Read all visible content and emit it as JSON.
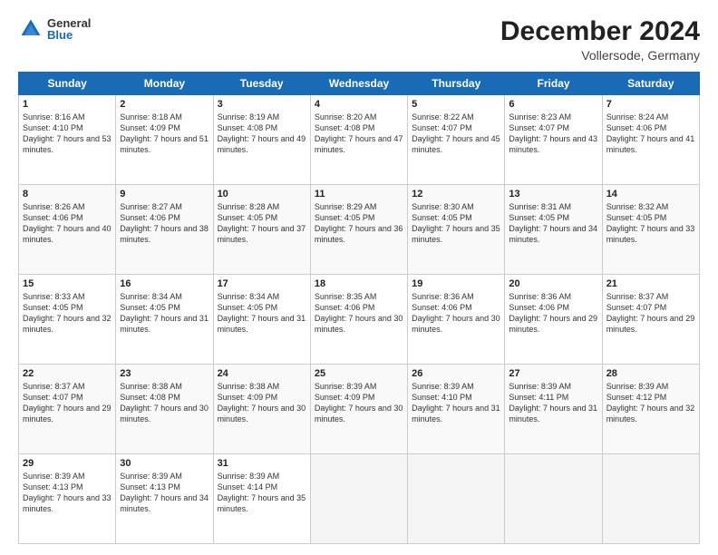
{
  "logo": {
    "general": "General",
    "blue": "Blue"
  },
  "title": {
    "month": "December 2024",
    "location": "Vollersode, Germany"
  },
  "days_of_week": [
    "Sunday",
    "Monday",
    "Tuesday",
    "Wednesday",
    "Thursday",
    "Friday",
    "Saturday"
  ],
  "weeks": [
    [
      {
        "day": "1",
        "sunrise": "8:16 AM",
        "sunset": "4:10 PM",
        "daylight": "7 hours and 53 minutes."
      },
      {
        "day": "2",
        "sunrise": "8:18 AM",
        "sunset": "4:09 PM",
        "daylight": "7 hours and 51 minutes."
      },
      {
        "day": "3",
        "sunrise": "8:19 AM",
        "sunset": "4:08 PM",
        "daylight": "7 hours and 49 minutes."
      },
      {
        "day": "4",
        "sunrise": "8:20 AM",
        "sunset": "4:08 PM",
        "daylight": "7 hours and 47 minutes."
      },
      {
        "day": "5",
        "sunrise": "8:22 AM",
        "sunset": "4:07 PM",
        "daylight": "7 hours and 45 minutes."
      },
      {
        "day": "6",
        "sunrise": "8:23 AM",
        "sunset": "4:07 PM",
        "daylight": "7 hours and 43 minutes."
      },
      {
        "day": "7",
        "sunrise": "8:24 AM",
        "sunset": "4:06 PM",
        "daylight": "7 hours and 41 minutes."
      }
    ],
    [
      {
        "day": "8",
        "sunrise": "8:26 AM",
        "sunset": "4:06 PM",
        "daylight": "7 hours and 40 minutes."
      },
      {
        "day": "9",
        "sunrise": "8:27 AM",
        "sunset": "4:06 PM",
        "daylight": "7 hours and 38 minutes."
      },
      {
        "day": "10",
        "sunrise": "8:28 AM",
        "sunset": "4:05 PM",
        "daylight": "7 hours and 37 minutes."
      },
      {
        "day": "11",
        "sunrise": "8:29 AM",
        "sunset": "4:05 PM",
        "daylight": "7 hours and 36 minutes."
      },
      {
        "day": "12",
        "sunrise": "8:30 AM",
        "sunset": "4:05 PM",
        "daylight": "7 hours and 35 minutes."
      },
      {
        "day": "13",
        "sunrise": "8:31 AM",
        "sunset": "4:05 PM",
        "daylight": "7 hours and 34 minutes."
      },
      {
        "day": "14",
        "sunrise": "8:32 AM",
        "sunset": "4:05 PM",
        "daylight": "7 hours and 33 minutes."
      }
    ],
    [
      {
        "day": "15",
        "sunrise": "8:33 AM",
        "sunset": "4:05 PM",
        "daylight": "7 hours and 32 minutes."
      },
      {
        "day": "16",
        "sunrise": "8:34 AM",
        "sunset": "4:05 PM",
        "daylight": "7 hours and 31 minutes."
      },
      {
        "day": "17",
        "sunrise": "8:34 AM",
        "sunset": "4:05 PM",
        "daylight": "7 hours and 31 minutes."
      },
      {
        "day": "18",
        "sunrise": "8:35 AM",
        "sunset": "4:06 PM",
        "daylight": "7 hours and 30 minutes."
      },
      {
        "day": "19",
        "sunrise": "8:36 AM",
        "sunset": "4:06 PM",
        "daylight": "7 hours and 30 minutes."
      },
      {
        "day": "20",
        "sunrise": "8:36 AM",
        "sunset": "4:06 PM",
        "daylight": "7 hours and 29 minutes."
      },
      {
        "day": "21",
        "sunrise": "8:37 AM",
        "sunset": "4:07 PM",
        "daylight": "7 hours and 29 minutes."
      }
    ],
    [
      {
        "day": "22",
        "sunrise": "8:37 AM",
        "sunset": "4:07 PM",
        "daylight": "7 hours and 29 minutes."
      },
      {
        "day": "23",
        "sunrise": "8:38 AM",
        "sunset": "4:08 PM",
        "daylight": "7 hours and 30 minutes."
      },
      {
        "day": "24",
        "sunrise": "8:38 AM",
        "sunset": "4:09 PM",
        "daylight": "7 hours and 30 minutes."
      },
      {
        "day": "25",
        "sunrise": "8:39 AM",
        "sunset": "4:09 PM",
        "daylight": "7 hours and 30 minutes."
      },
      {
        "day": "26",
        "sunrise": "8:39 AM",
        "sunset": "4:10 PM",
        "daylight": "7 hours and 31 minutes."
      },
      {
        "day": "27",
        "sunrise": "8:39 AM",
        "sunset": "4:11 PM",
        "daylight": "7 hours and 31 minutes."
      },
      {
        "day": "28",
        "sunrise": "8:39 AM",
        "sunset": "4:12 PM",
        "daylight": "7 hours and 32 minutes."
      }
    ],
    [
      {
        "day": "29",
        "sunrise": "8:39 AM",
        "sunset": "4:13 PM",
        "daylight": "7 hours and 33 minutes."
      },
      {
        "day": "30",
        "sunrise": "8:39 AM",
        "sunset": "4:13 PM",
        "daylight": "7 hours and 34 minutes."
      },
      {
        "day": "31",
        "sunrise": "8:39 AM",
        "sunset": "4:14 PM",
        "daylight": "7 hours and 35 minutes."
      },
      null,
      null,
      null,
      null
    ]
  ],
  "labels": {
    "sunrise": "Sunrise:",
    "sunset": "Sunset:",
    "daylight": "Daylight:"
  }
}
